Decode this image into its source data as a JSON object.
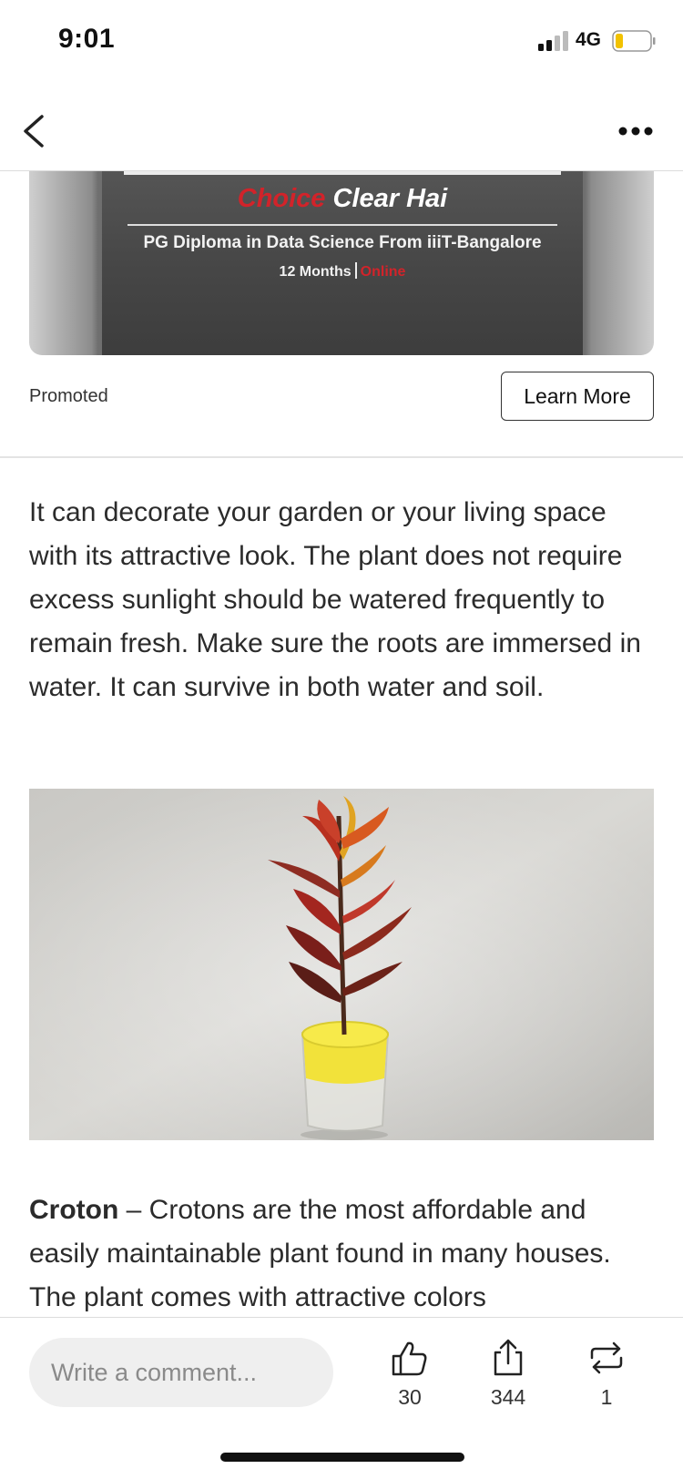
{
  "status_bar": {
    "time": "9:01",
    "network": "4G",
    "icons": [
      "signal-icon",
      "battery-icon"
    ]
  },
  "nav": {
    "icons": [
      "back-chevron-icon",
      "more-icon"
    ]
  },
  "ad": {
    "headline_choice": "Choice",
    "headline_rest": "Clear Hai",
    "subtitle": "PG Diploma in Data Science From iiiT-Bangalore",
    "duration": "12 Months",
    "mode": "Online",
    "promoted_label": "Promoted",
    "cta_label": "Learn More",
    "colors": {
      "accent_red": "#d2232a",
      "banner_dark": "#4a4a4a"
    }
  },
  "article": {
    "paragraph1": "It can decorate your garden or your living space with its attractive look. The plant does not require excess sunlight should be watered frequently to remain fresh. Make sure the roots are immersed in water. It can survive in both water and soil.",
    "croton_title": "Croton",
    "croton_text": " – Crotons are the most affordable and easily maintainable plant found in many houses. The plant comes with attractive colors"
  },
  "bottom_bar": {
    "comment_placeholder": "Write a comment...",
    "like_count": "30",
    "share_count": "344",
    "repost_count": "1",
    "icons": [
      "like-icon",
      "share-icon",
      "repost-icon"
    ]
  }
}
